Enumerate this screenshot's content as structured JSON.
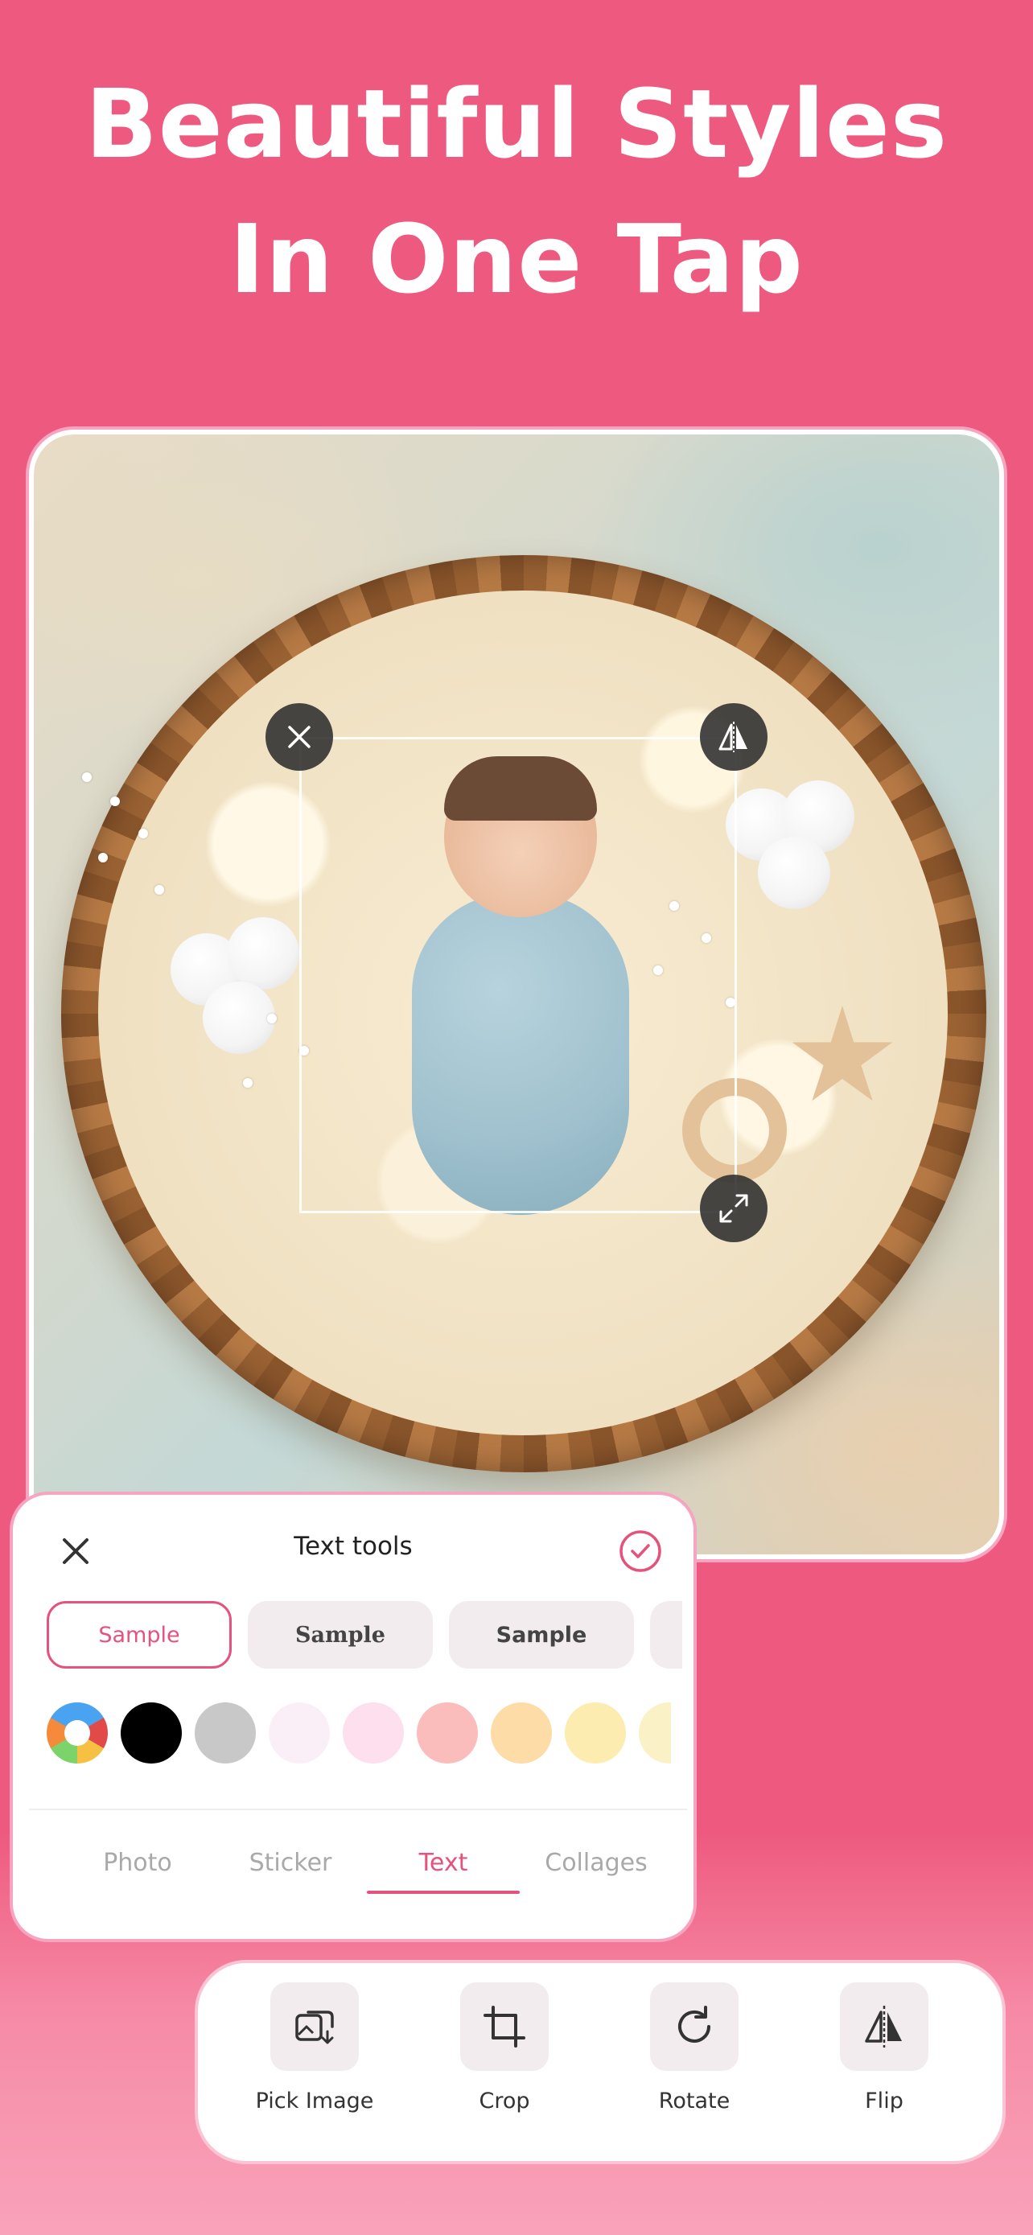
{
  "headline": {
    "line1": "Beautiful Styles",
    "line2": "In One Tap"
  },
  "text_tools": {
    "title": "Text tools",
    "style_chips": [
      {
        "label": "Sample",
        "selected": true
      },
      {
        "label": "Sample",
        "selected": false
      },
      {
        "label": "Sample",
        "selected": false
      },
      {
        "label": "",
        "selected": false
      }
    ],
    "colors": [
      "multicolor",
      "#000000",
      "#c8c8c8",
      "#fbeff7",
      "#fddfee",
      "#fbbcbc",
      "#fddca8",
      "#fdecb0",
      "#fbf1c6"
    ],
    "tabs": [
      {
        "label": "Photo",
        "active": false
      },
      {
        "label": "Sticker",
        "active": false
      },
      {
        "label": "Text",
        "active": true
      },
      {
        "label": "Collages",
        "active": false
      }
    ]
  },
  "toolbar": {
    "tools": [
      {
        "label": "Pick Image",
        "icon": "pick-image-icon"
      },
      {
        "label": "Crop",
        "icon": "crop-icon"
      },
      {
        "label": "Rotate",
        "icon": "rotate-icon"
      },
      {
        "label": "Flip",
        "icon": "flip-icon"
      }
    ]
  },
  "colors": {
    "background": "#ee5a7f",
    "accent": "#e5527c",
    "panel_border": "#f6a4c0"
  }
}
